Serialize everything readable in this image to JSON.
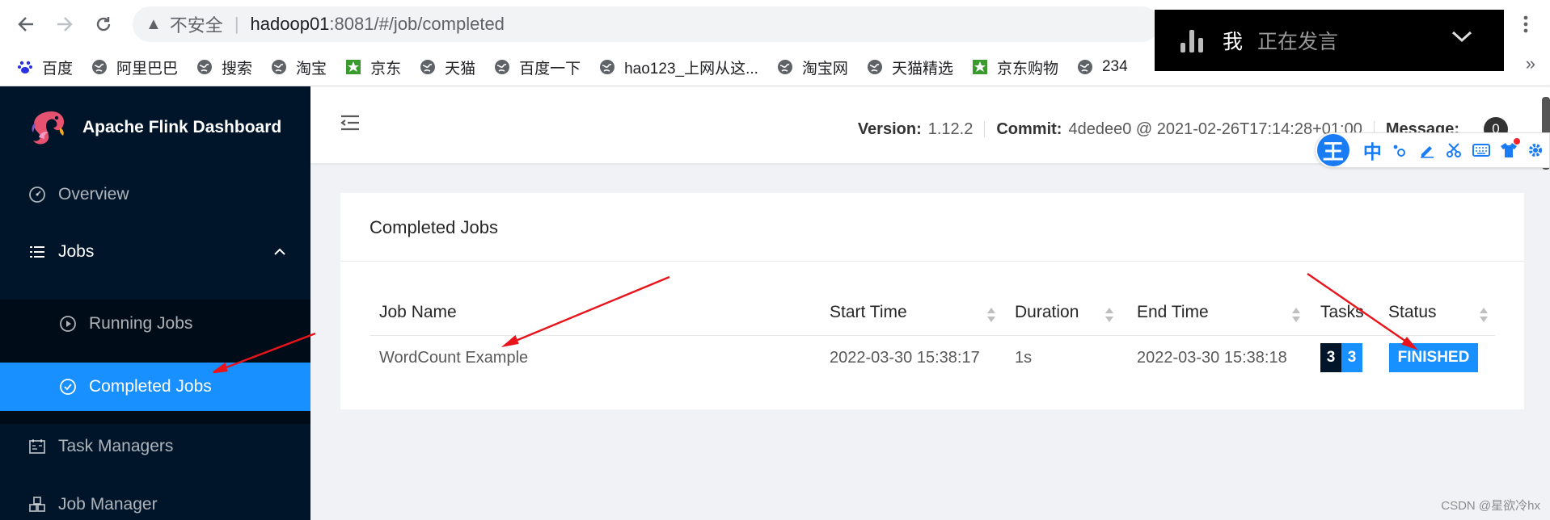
{
  "browser": {
    "security_label": "不安全",
    "url_host": "hadoop01",
    "url_path": ":8081/#/job/completed",
    "bookmarks": [
      {
        "label": "百度"
      },
      {
        "label": "阿里巴巴"
      },
      {
        "label": "搜索"
      },
      {
        "label": "淘宝"
      },
      {
        "label": "京东"
      },
      {
        "label": "天猫"
      },
      {
        "label": "百度一下"
      },
      {
        "label": "hao123_上网从这..."
      },
      {
        "label": "淘宝网"
      },
      {
        "label": "天猫精选"
      },
      {
        "label": "京东购物"
      },
      {
        "label": "234"
      }
    ],
    "more_bookmarks": "»"
  },
  "voice_overlay": {
    "speaker": "我",
    "status": "正在发言"
  },
  "sidebar": {
    "app_name": "Apache Flink Dashboard",
    "items": {
      "overview": "Overview",
      "jobs": "Jobs",
      "running_jobs": "Running Jobs",
      "completed_jobs": "Completed Jobs",
      "task_managers": "Task Managers",
      "job_manager": "Job Manager"
    },
    "colors": {
      "background": "#001529",
      "selected": "#1890ff"
    }
  },
  "header": {
    "version_label": "Version:",
    "version_value": "1.12.2",
    "commit_label": "Commit:",
    "commit_value": "4dedee0 @ 2021-02-26T17:14:28+01:00",
    "message_label": "Message:",
    "message_count": "0"
  },
  "ime": {
    "logo": "王",
    "lang": "中",
    "icons": [
      "moon-dot-icon",
      "pen-icon",
      "scissors-icon",
      "keyboard-icon",
      "shirt-icon",
      "gear-icon"
    ]
  },
  "card": {
    "title": "Completed Jobs",
    "columns": {
      "job_name": "Job Name",
      "start_time": "Start Time",
      "duration": "Duration",
      "end_time": "End Time",
      "tasks": "Tasks",
      "status": "Status"
    },
    "rows": [
      {
        "job_name": "WordCount Example",
        "start_time": "2022-03-30 15:38:17",
        "duration": "1s",
        "end_time": "2022-03-30 15:38:18",
        "tasks_total": "3",
        "tasks_finished": "3",
        "status": "FINISHED"
      }
    ]
  },
  "watermark": "CSDN @星欲冷hx"
}
